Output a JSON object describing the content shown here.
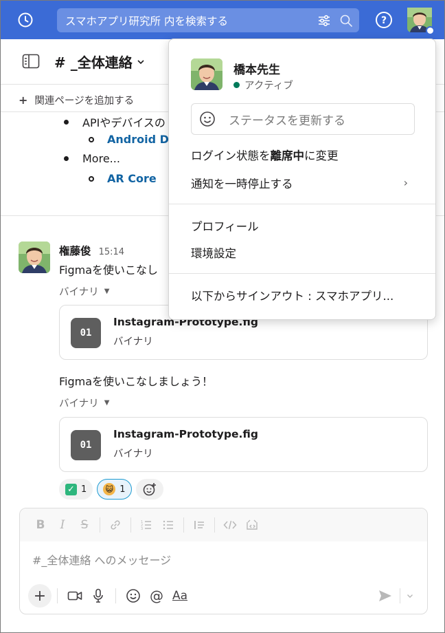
{
  "search": {
    "text": "スマホアプリ研究所 内を検索する"
  },
  "channel": {
    "name": "# _全体連絡",
    "add_page_label": "関連ページを追加する"
  },
  "bullets": [
    {
      "text": "APIやデバイスの"
    },
    {
      "link": "Android De"
    },
    {
      "text": "More..."
    },
    {
      "link": "AR Core"
    }
  ],
  "message": {
    "author": "権藤俊",
    "time": "15:14",
    "text_1": "Figmaを使いこなし",
    "text_2": "Figmaを使いこなしましょう！",
    "file_label": "バイナリ",
    "files": [
      {
        "icon_text": "01",
        "name": "Instagram-Prototype.fig",
        "type": "バイナリ"
      },
      {
        "icon_text": "01",
        "name": "Instagram-Prototype.fig",
        "type": "バイナリ"
      }
    ],
    "reactions": [
      {
        "emoji": "white-check-mark",
        "count": "1"
      },
      {
        "emoji": "smiley-cat",
        "count": "1"
      }
    ]
  },
  "composer": {
    "placeholder": "#_全体連絡 へのメッセージ",
    "format_label": "Aa"
  },
  "menu": {
    "user_name": "橋本先生",
    "presence": "アクティブ",
    "status_placeholder": "ステータスを更新する",
    "away_prefix": "ログイン状態を",
    "away_bold": "離席中",
    "away_suffix": "に変更",
    "pause_notifications": "通知を一時停止する",
    "profile": "プロフィール",
    "preferences": "環境設定",
    "sign_out": "以下からサインアウト : スマホアプリ..."
  },
  "colors": {
    "topbar": "#3b6bd6",
    "link": "#1264a3",
    "active_green": "#007a5a"
  }
}
